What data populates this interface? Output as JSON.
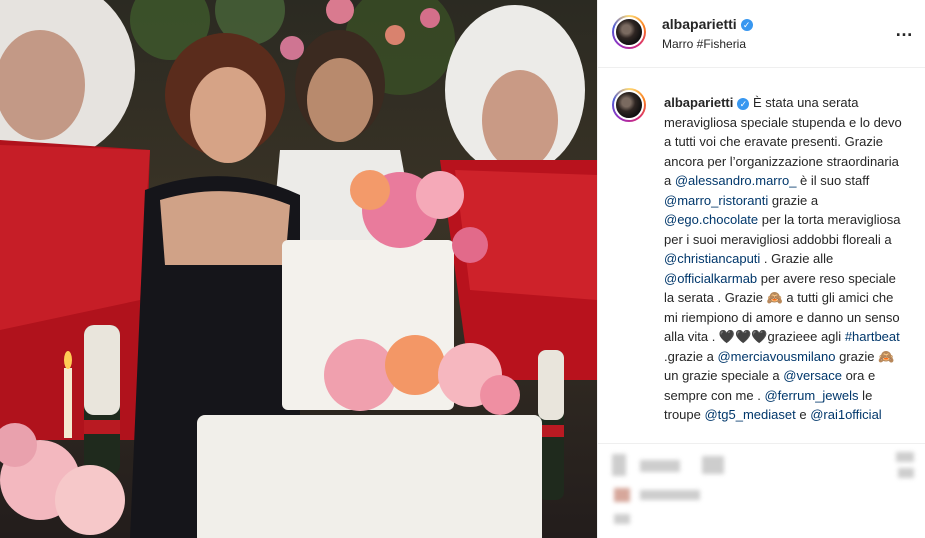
{
  "post": {
    "username": "albaparietti",
    "location": "Marro #Fisheria",
    "more_icon": "…",
    "verified_icon": "✓"
  },
  "caption": {
    "username": "albaparietti",
    "segments": [
      {
        "t": "È stata una serata meravigliosa speciale stupenda e lo devo a tutti voi che eravate presenti. Grazie ancora per l’organizzazione straordinaria a ",
        "m": false
      },
      {
        "t": "@alessandro.marro_",
        "m": true
      },
      {
        "t": " è il suo staff ",
        "m": false
      },
      {
        "t": "@marro_ristoranti",
        "m": true
      },
      {
        "t": " grazie a ",
        "m": false
      },
      {
        "t": "@ego.chocolate",
        "m": true
      },
      {
        "t": " per la torta meravigliosa per i suoi meravigliosi addobbi floreali a ",
        "m": false
      },
      {
        "t": "@christiancaputi",
        "m": true
      },
      {
        "t": " . Grazie alle ",
        "m": false
      },
      {
        "t": "@officialkarmab",
        "m": true
      },
      {
        "t": " per avere reso speciale la serata . Grazie 🙈 a tutti gli amici che mi riempiono di amore e danno un senso alla vita . 🖤🖤🖤grazieee agli ",
        "m": false
      },
      {
        "t": "#hartbeat",
        "m": true
      },
      {
        "t": " .grazie a ",
        "m": false
      },
      {
        "t": "@merciavousmilano",
        "m": true
      },
      {
        "t": " grazie 🙈 un grazie speciale a ",
        "m": false
      },
      {
        "t": "@versace",
        "m": true
      },
      {
        "t": " ora e sempre con me . ",
        "m": false
      },
      {
        "t": "@ferrum_jewels",
        "m": true
      },
      {
        "t": " le troupe ",
        "m": false
      },
      {
        "t": "@tg5_mediaset",
        "m": true
      },
      {
        "t": " e ",
        "m": false
      },
      {
        "t": "@rai1official",
        "m": true
      }
    ]
  },
  "colors": {
    "mention": "#00376b",
    "text": "#262626",
    "verified": "#3897f0",
    "dress_red": "#c0131f",
    "cake_white": "#f3f1ec"
  }
}
